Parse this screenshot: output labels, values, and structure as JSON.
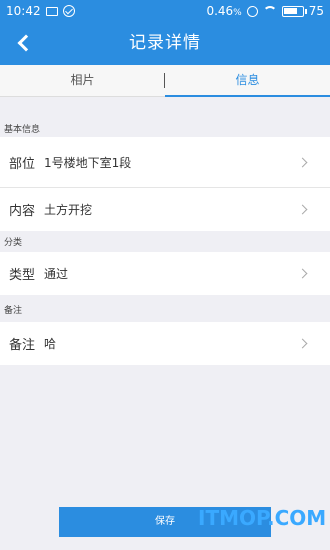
{
  "status_bar": {
    "time": "10:42",
    "network_speed": "0.46",
    "speed_unit": "%",
    "battery_level": "75",
    "battery_fraction": 0.75
  },
  "header": {
    "title": "记录详情"
  },
  "tabs": [
    {
      "label": "相片",
      "active": false
    },
    {
      "label": "信息",
      "active": true
    }
  ],
  "sections": {
    "basic_info": "基本信息",
    "category": "分类",
    "remarks": "备注"
  },
  "rows": {
    "location": {
      "key": "部位",
      "value": "1号楼地下室1段"
    },
    "content": {
      "key": "内容",
      "value": "土方开挖"
    },
    "type": {
      "key": "类型",
      "value": "通过"
    },
    "note": {
      "key": "备注",
      "value": "哈"
    }
  },
  "footer": {
    "save_label": "保存"
  },
  "watermark": "ITMOP.COM",
  "colors": {
    "primary": "#2b8de0",
    "background": "#efeff4"
  }
}
